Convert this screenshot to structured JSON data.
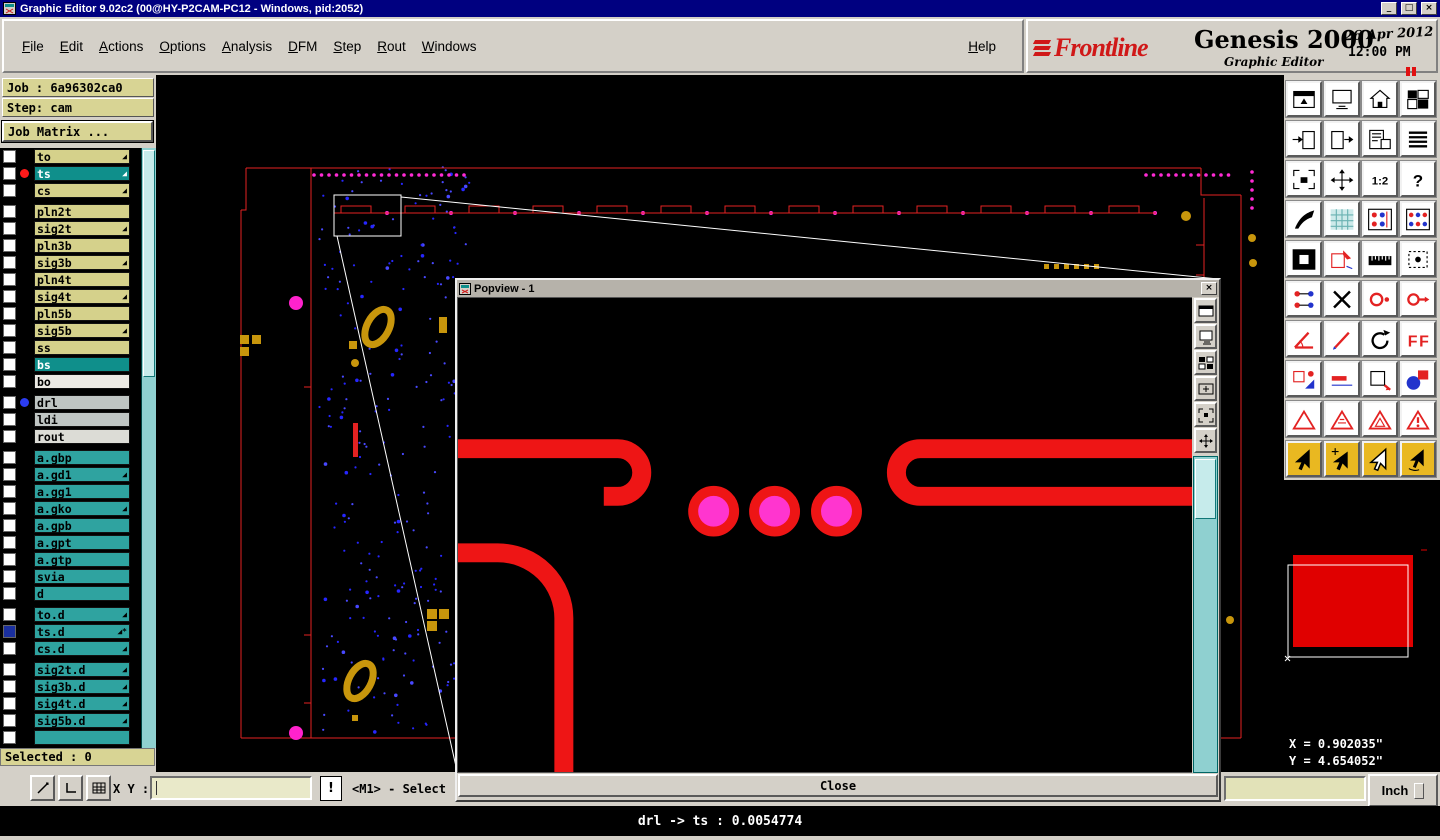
{
  "window": {
    "title": "Graphic Editor 9.02c2 (00@HY-P2CAM-PC12 - Windows, pid:2052)",
    "minimize": "_",
    "maximize": "□",
    "close": "×"
  },
  "menu": {
    "items": [
      "File",
      "Edit",
      "Actions",
      "Options",
      "Analysis",
      "DFM",
      "Step",
      "Rout",
      "Windows"
    ],
    "help": "Help"
  },
  "brand": {
    "logo": "Frontline",
    "product": "Genesis 2000",
    "subtitle": "Graphic Editor",
    "date": "26 Apr 2012",
    "time": "12:00 PM"
  },
  "job": {
    "job_label": "Job : 6a96302ca0",
    "step_label": "Step: cam",
    "matrix_button": "Job Matrix ..."
  },
  "layers": [
    {
      "name": "to",
      "style": "khaki",
      "mark": "arr"
    },
    {
      "name": "ts",
      "style": "tealdark",
      "dot": "#ff1a1a",
      "mark": "arr"
    },
    {
      "name": "cs",
      "style": "khaki",
      "mark": "arr"
    },
    {
      "spacer": true
    },
    {
      "name": "pln2t",
      "style": "khaki"
    },
    {
      "name": "sig2t",
      "style": "khaki",
      "mark": "arr"
    },
    {
      "name": "pln3b",
      "style": "khaki"
    },
    {
      "name": "sig3b",
      "style": "khaki",
      "mark": "arr"
    },
    {
      "name": "pln4t",
      "style": "khaki"
    },
    {
      "name": "sig4t",
      "style": "khaki",
      "mark": "arr"
    },
    {
      "name": "pln5b",
      "style": "khaki"
    },
    {
      "name": "sig5b",
      "style": "khaki",
      "mark": "arr"
    },
    {
      "name": "ss",
      "style": "khaki"
    },
    {
      "name": "bs",
      "style": "tealdark"
    },
    {
      "name": "bo",
      "style": "white"
    },
    {
      "spacer": true
    },
    {
      "name": "drl",
      "style": "gray",
      "dot": "#2b3cf0"
    },
    {
      "name": "ldi",
      "style": "gray"
    },
    {
      "name": "rout",
      "style": "light"
    },
    {
      "spacer": true
    },
    {
      "name": "a.gbp",
      "style": "teal"
    },
    {
      "name": "a.gd1",
      "style": "teal",
      "mark": "arr"
    },
    {
      "name": "a.gg1",
      "style": "teal"
    },
    {
      "name": "a.gko",
      "style": "teal",
      "mark": "arr"
    },
    {
      "name": "a.gpb",
      "style": "teal"
    },
    {
      "name": "a.gpt",
      "style": "teal"
    },
    {
      "name": "a.gtp",
      "style": "teal"
    },
    {
      "name": "svia",
      "style": "teal"
    },
    {
      "name": "d",
      "style": "teal"
    },
    {
      "spacer": true
    },
    {
      "name": "to.d",
      "style": "teal",
      "mark": "arr"
    },
    {
      "name": "ts.d",
      "style": "teal",
      "box": "navy",
      "mark": "arr2"
    },
    {
      "name": "cs.d",
      "style": "teal",
      "mark": "arr"
    },
    {
      "spacer": true
    },
    {
      "name": "sig2t.d",
      "style": "teal",
      "mark": "arr"
    },
    {
      "name": "sig3b.d",
      "style": "teal",
      "mark": "arr"
    },
    {
      "name": "sig4t.d",
      "style": "teal",
      "mark": "arr"
    },
    {
      "name": "sig5b.d",
      "style": "teal",
      "mark": "arr"
    },
    {
      "name": "",
      "style": "teal"
    }
  ],
  "selected_label": "Selected : 0",
  "bottom": {
    "xy_label": "X Y :",
    "xy_value": "",
    "exclaim": "!",
    "mode_label": "<M1> - Select",
    "units_label": "Inch"
  },
  "popup": {
    "title": "Popview - 1",
    "close_label": "Close",
    "close_x": "×"
  },
  "coords": {
    "x_label": "X = 0.902035\"",
    "y_label": "Y = 4.654052\""
  },
  "statusbar": {
    "message": "drl -> ts : 0.0054774"
  },
  "toolbar": {
    "zoom_ratio_label": "1:2",
    "help_label": "?",
    "f_label": "F",
    "accent_red": "#e32222",
    "accent_blue": "#2233cc",
    "accent_magenta": "#ff2ad4",
    "icons": [
      "shade-window",
      "monitor",
      "home-view",
      "tile-windows",
      "import-view",
      "export-view",
      "preview-page",
      "layer-stack",
      "zoom-extents",
      "pan-arrows",
      "zoom-ratio",
      "help",
      "knife",
      "grid",
      "pad-grid",
      "pad-grid-alt",
      "negative-view",
      "shape-edit",
      "ruler",
      "selection-box",
      "net-connect",
      "delete-cross",
      "circle-pick",
      "circle-arrow",
      "angle-measure",
      "slash-measure",
      "rotate",
      "text-mirror",
      "pad-edit",
      "line-width",
      "transform-box",
      "shapes",
      "dfm-triangle",
      "dfm-triangle-lines",
      "dfm-triangle-inner",
      "dfm-triangle-mark",
      "select-arrow",
      "select-arrow-plus",
      "select-arrow-open",
      "select-arrow-rotate"
    ]
  }
}
